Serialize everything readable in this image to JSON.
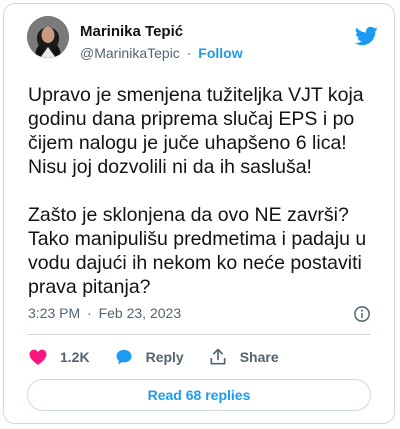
{
  "author": {
    "name": "Marinika Tepić",
    "handle": "@MarinikaTepic",
    "separator": "·",
    "follow_label": "Follow"
  },
  "tweet": {
    "text": "Upravo je smenjena tužiteljka VJT koja godinu dana priprema slučaj EPS i po čijem nalogu je juče uhapšeno 6 lica! Nisu joj dozvolili ni da ih sasluša!\n\nZašto je sklonjena da ovo NE završi? Tako manipulišu predmetima i padaju u vodu dajući ih nekom ko neće postaviti prava pitanja?",
    "time": "3:23 PM",
    "separator": "·",
    "date": "Feb 23, 2023"
  },
  "actions": {
    "like_count": "1.2K",
    "reply_label": "Reply",
    "share_label": "Share"
  },
  "replies_button_label": "Read 68 replies",
  "colors": {
    "brand": "#1d9bf0",
    "like": "#f91880",
    "text": "#0f1419",
    "muted": "#536471",
    "border": "#cfd9de"
  },
  "icons": [
    "twitter-bird-icon",
    "info-icon",
    "heart-icon",
    "reply-bubble-icon",
    "share-icon"
  ]
}
